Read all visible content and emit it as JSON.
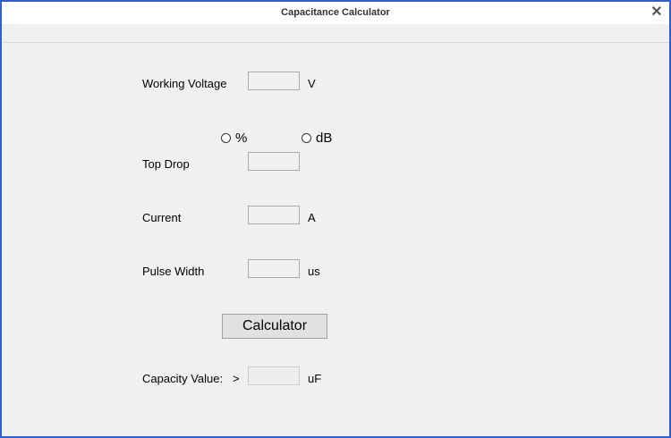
{
  "window": {
    "title": "Capacitance Calculator",
    "close_glyph": "✕"
  },
  "form": {
    "working_voltage": {
      "label": "Working Voltage",
      "value": "",
      "unit": "V"
    },
    "drop_mode": {
      "options": [
        "%",
        "dB"
      ]
    },
    "top_drop": {
      "label": "Top Drop",
      "value": ""
    },
    "current": {
      "label": "Current",
      "value": "",
      "unit": "A"
    },
    "pulse_width": {
      "label": "Pulse Width",
      "value": "",
      "unit": "us"
    },
    "calculate_button": "Calculator",
    "capacity": {
      "label": "Capacity Value:",
      "operator": ">",
      "value": "",
      "unit": "uF"
    }
  },
  "colors": {
    "border": "#2f5fd0",
    "background": "#f0f0f0",
    "button": "#e1e1e1"
  }
}
